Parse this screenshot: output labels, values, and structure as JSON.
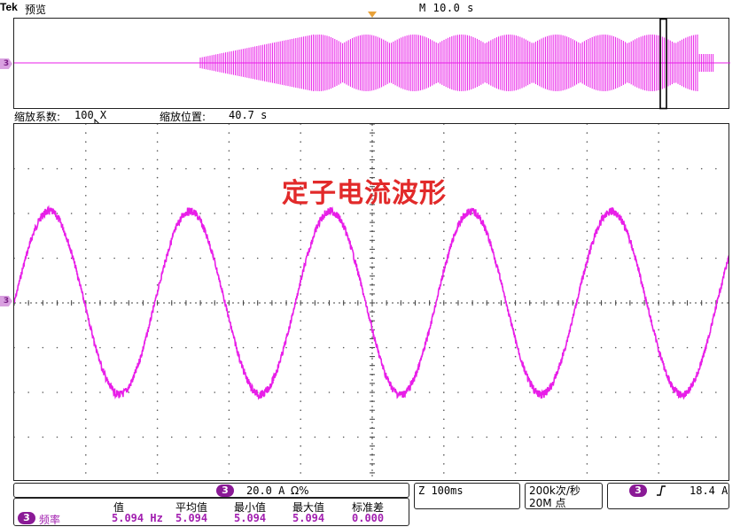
{
  "header": {
    "brand": "Tek",
    "preview_label": "预览",
    "timebase": "M 10.0 s"
  },
  "zoom": {
    "factor_label": "缩放系数:",
    "factor_value": "100 X",
    "position_label": "缩放位置:",
    "position_value": "40.7 s"
  },
  "channel": {
    "number": "3",
    "color": "#e81ee8",
    "scale": "20.0 A",
    "unit_symbol": "Ω%"
  },
  "waveform_title": "定子电流波形",
  "horizontal": {
    "label": "Z 100ms"
  },
  "sample_rate": {
    "rate": "200k次/秒",
    "points": "20M 点"
  },
  "trigger": {
    "channel": "3",
    "slope_icon": "rising-edge-icon",
    "level": "18.4 A"
  },
  "measurements": {
    "headers": [
      "值",
      "平均值",
      "最小值",
      "最大值",
      "标准差"
    ],
    "rows": [
      {
        "channel": "3",
        "name": "频率",
        "value": "5.094 Hz",
        "mean": "5.094",
        "min": "5.094",
        "max": "5.094",
        "std": "0.000"
      }
    ]
  },
  "chart_data": {
    "type": "line",
    "title": "定子电流波形",
    "xlabel": "",
    "ylabel": "",
    "series": [
      {
        "frequency_hz": 5.094,
        "peak_divisions": 2.05,
        "time_per_division_ms": 100,
        "cycles_visible": 5.1
      }
    ],
    "grid": true
  }
}
